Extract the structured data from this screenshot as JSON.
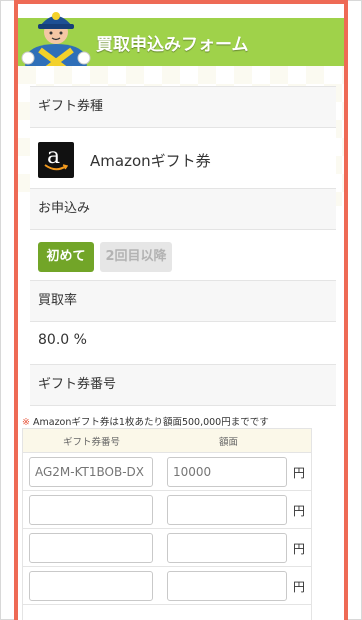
{
  "header": {
    "title": "買取申込みフォーム"
  },
  "gift_type": {
    "label": "ギフト券種",
    "name": "Amazonギフト券",
    "logo_letter": "a"
  },
  "application": {
    "label": "お申込み",
    "first_button": "初めて",
    "repeat_button": "2回目以降"
  },
  "rate": {
    "label": "買取率",
    "value": "80.0 %"
  },
  "gift_code": {
    "label": "ギフト券番号",
    "notice_mark": "※",
    "notice": "Amazonギフト券は1枚あたり額面500,000円までです",
    "col_code": "ギフト券番号",
    "col_amount": "額面",
    "yen": "円",
    "rows": [
      {
        "code_placeholder": "AG2M-KT1BOB-DX",
        "amount_placeholder": "10000"
      },
      {
        "code_placeholder": "",
        "amount_placeholder": ""
      },
      {
        "code_placeholder": "",
        "amount_placeholder": ""
      },
      {
        "code_placeholder": "",
        "amount_placeholder": ""
      }
    ]
  },
  "colors": {
    "frame_border": "#ee6a55",
    "header_bg": "#9fd24a",
    "primary_button": "#72a528",
    "notice_mark": "#e85a40"
  }
}
